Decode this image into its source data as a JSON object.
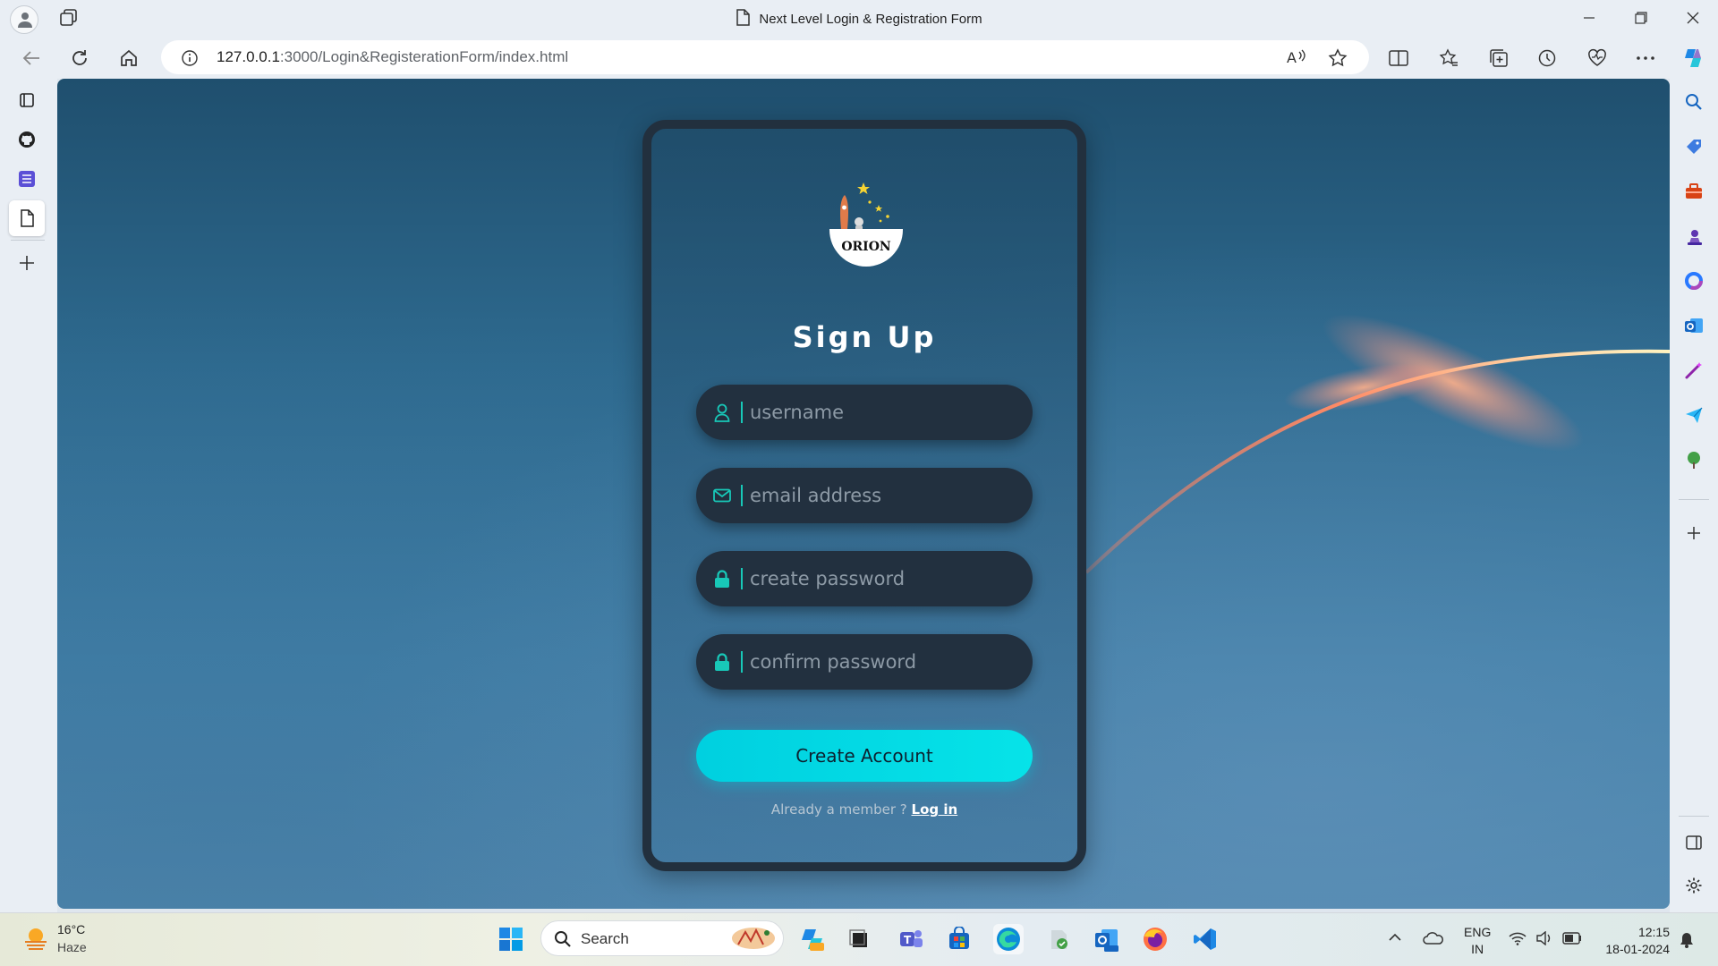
{
  "browser": {
    "tab_title": "Next Level Login & Registration Form",
    "url_host": "127.0.0.1",
    "url_rest": ":3000/Login&RegisterationForm/index.html"
  },
  "page": {
    "logo_text": "ORION",
    "heading": "Sign Up",
    "fields": [
      {
        "placeholder": "username",
        "icon": "user-icon"
      },
      {
        "placeholder": "email address",
        "icon": "envelope-icon"
      },
      {
        "placeholder": "create password",
        "icon": "lock-icon"
      },
      {
        "placeholder": "confirm password",
        "icon": "lock-icon"
      }
    ],
    "submit_label": "Create Account",
    "member_text": "Already a member ? ",
    "login_link": "Log in",
    "accent_color": "#00d9e6"
  },
  "taskbar": {
    "weather_temp": "16°C",
    "weather_desc": "Haze",
    "search_label": "Search",
    "language": "ENG",
    "region": "IN",
    "time": "12:15",
    "date": "18-01-2024"
  }
}
